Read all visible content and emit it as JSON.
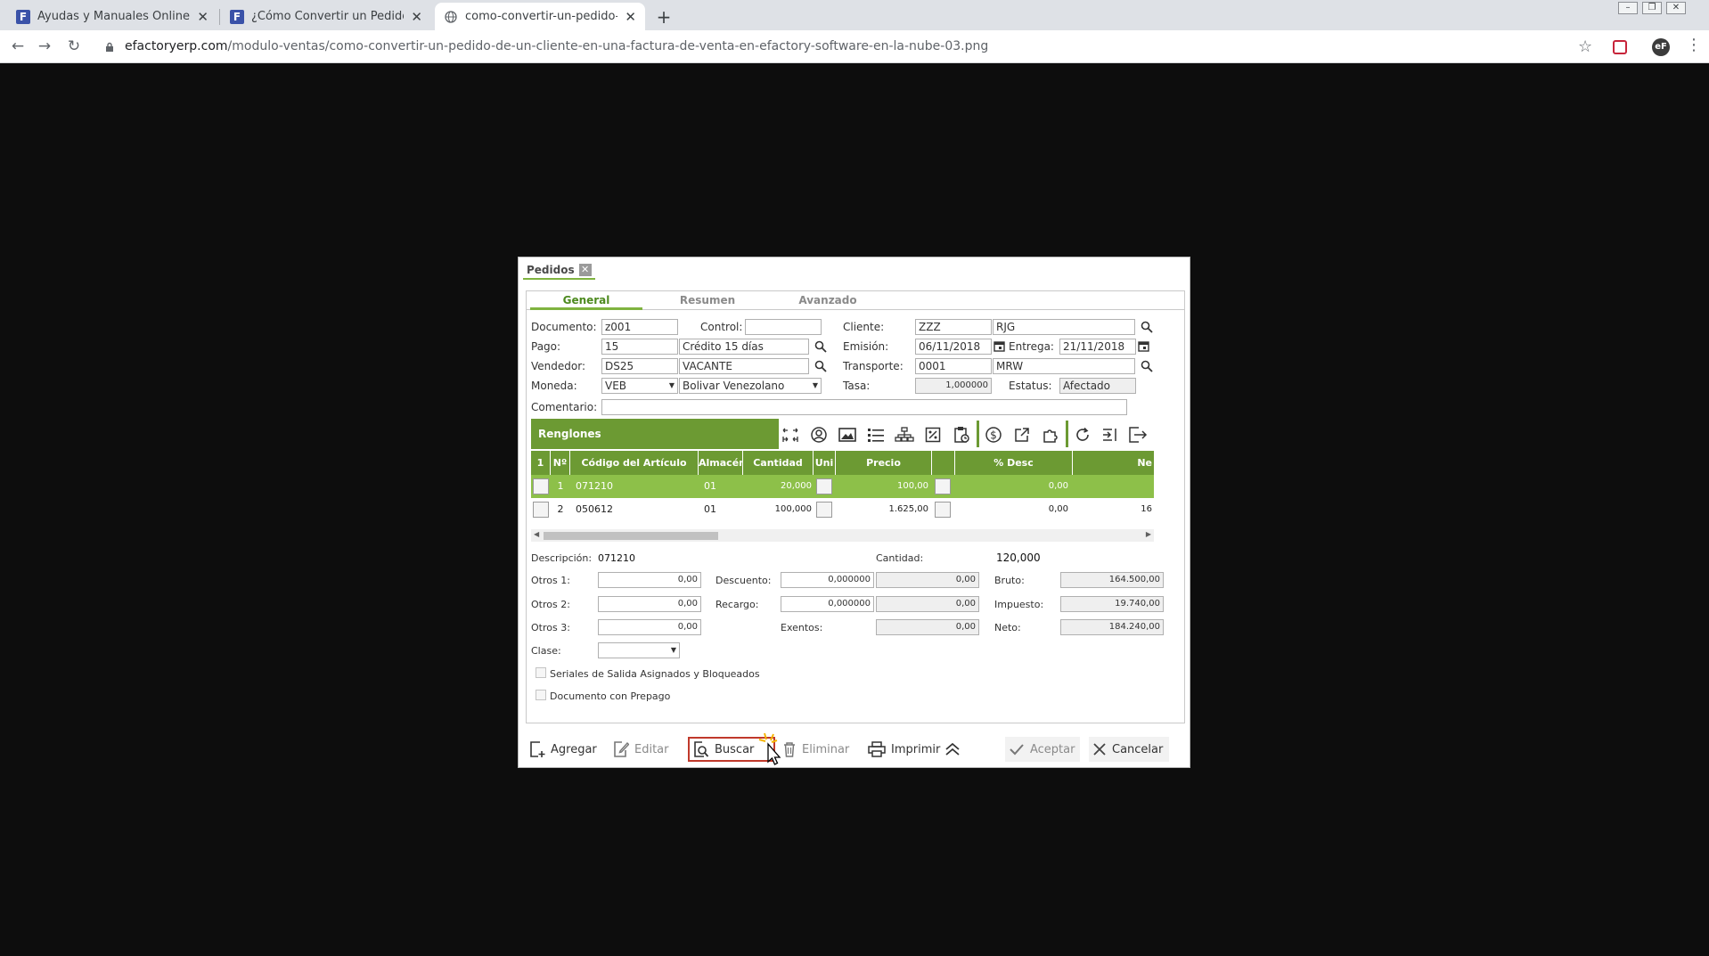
{
  "browser": {
    "tabs": [
      {
        "title": "Ayudas y Manuales Online de eF",
        "favicon": "F",
        "active": false
      },
      {
        "title": "¿Cómo Convertir un Pedido de u",
        "favicon": "F",
        "active": false
      },
      {
        "title": "como-convertir-un-pedido-de-u",
        "favicon": "globe",
        "active": true
      }
    ],
    "url_host": "efactoryerp.com",
    "url_path": "/modulo-ventas/como-convertir-un-pedido-de-un-cliente-en-una-factura-de-venta-en-efactory-software-en-la-nube-03.png",
    "close_glyph": "✕",
    "newtab_glyph": "+"
  },
  "dialog": {
    "tab_label": "Pedidos",
    "close_glyph": "✕",
    "subtabs": [
      "General",
      "Resumen",
      "Avanzado"
    ],
    "active_subtab": "General",
    "fields": {
      "documento_label": "Documento:",
      "documento": "z001",
      "control_label": "Control:",
      "control": "",
      "cliente_label": "Cliente:",
      "cliente_code": "ZZZ",
      "cliente_name": "RJG",
      "pago_label": "Pago:",
      "pago_code": "15",
      "pago_name": "Crédito 15 días",
      "emision_label": "Emisión:",
      "emision": "06/11/2018",
      "entrega_label": "Entrega:",
      "entrega": "21/11/2018",
      "vendedor_label": "Vendedor:",
      "vendedor_code": "DS25",
      "vendedor_name": "VACANTE",
      "transporte_label": "Transporte:",
      "transporte_code": "0001",
      "transporte_name": "MRW",
      "moneda_label": "Moneda:",
      "moneda_code": "VEB",
      "moneda_name": "Bolivar Venezolano",
      "tasa_label": "Tasa:",
      "tasa": "1,000000",
      "estatus_label": "Estatus:",
      "estatus": "Afectado",
      "comentario_label": "Comentario:",
      "comentario": ""
    },
    "grid": {
      "title": "Renglones",
      "columns": [
        "1",
        "Nº",
        "Código del Artículo",
        "Almacén",
        "Cantidad",
        "Uni",
        "Precio",
        "",
        "% Desc",
        "Ne"
      ],
      "rows": [
        {
          "n": "1",
          "codigo": "071210",
          "almacen": "01",
          "cantidad": "20,000",
          "precio": "100,00",
          "desc": "0,00",
          "neto": ""
        },
        {
          "n": "2",
          "codigo": "050612",
          "almacen": "01",
          "cantidad": "100,000",
          "precio": "1.625,00",
          "desc": "0,00",
          "neto": "16"
        }
      ]
    },
    "summary": {
      "descripcion_label": "Descripción:",
      "descripcion": "071210",
      "cantidad_label": "Cantidad:",
      "cantidad": "120,000",
      "otros1_label": "Otros 1:",
      "otros1": "0,00",
      "otros2_label": "Otros 2:",
      "otros2": "0,00",
      "otros3_label": "Otros 3:",
      "otros3": "0,00",
      "descuento_label": "Descuento:",
      "descuento_pct": "0,000000",
      "descuento_amt": "0,00",
      "recargo_label": "Recargo:",
      "recargo_pct": "0,000000",
      "recargo_amt": "0,00",
      "exentos_label": "Exentos:",
      "exentos": "0,00",
      "bruto_label": "Bruto:",
      "bruto": "164.500,00",
      "impuesto_label": "Impuesto:",
      "impuesto": "19.740,00",
      "neto_label": "Neto:",
      "neto": "184.240,00",
      "clase_label": "Clase:",
      "clase": "",
      "seriales_label": "Seriales de Salida Asignados y Bloqueados",
      "prepago_label": "Documento con Prepago"
    },
    "buttons": {
      "agregar": "Agregar",
      "editar": "Editar",
      "buscar": "Buscar",
      "eliminar": "Eliminar",
      "imprimir": "Imprimir",
      "aceptar": "Aceptar",
      "cancelar": "Cancelar"
    }
  },
  "colors": {
    "accent_green": "#6c9a33",
    "row_highlight": "#8dc049",
    "page_bg": "#0d0d0d"
  }
}
